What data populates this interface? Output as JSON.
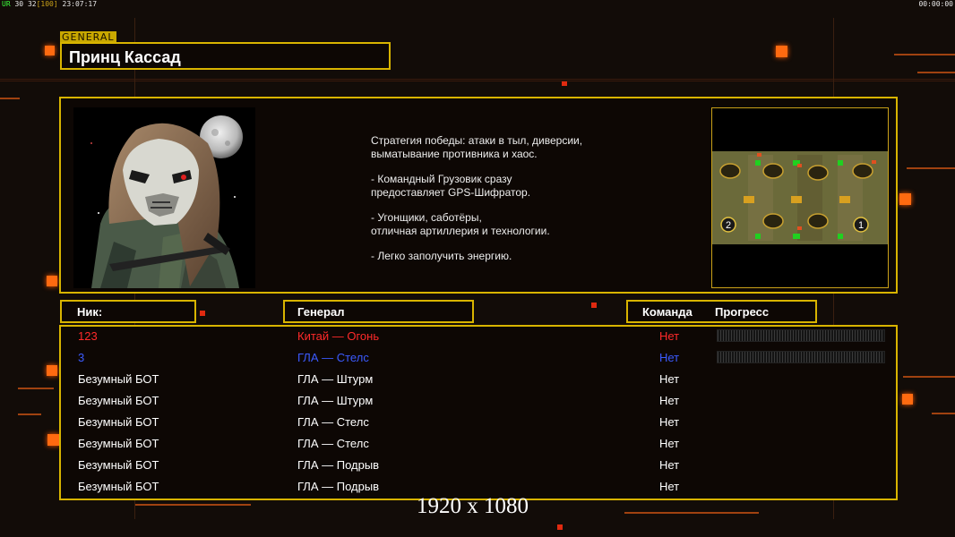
{
  "topbar": {
    "left_label": "UR",
    "left_fps": "30",
    "left_mid": "32",
    "left_bracket": "[100]",
    "left_time": "23:07:17",
    "right_time": "00:00:00"
  },
  "general_tag": "GENERAL",
  "general_name": "Принц Кассад",
  "description": [
    "Стратегия победы: атаки в тыл, диверсии,\n выматывание противника и хаос.",
    "- Командный Грузовик сразу\nпредоставляет GPS-Шифратор.",
    "- Угонщики, саботёры,\nотличная артиллерия и технологии.",
    "- Легко заполучить энергию."
  ],
  "map": {
    "spawn_labels": [
      "2",
      "1"
    ]
  },
  "headers": {
    "nick": "Ник:",
    "general": "Генерал",
    "team": "Команда",
    "progress": "Прогресс"
  },
  "players": [
    {
      "nick": "123",
      "general": "Китай — Огонь",
      "team": "Нет",
      "color": "#ff2a2a",
      "has_progress": true
    },
    {
      "nick": "3",
      "general": "ГЛА — Стелс",
      "team": "Нет",
      "color": "#3b5bff",
      "has_progress": true
    },
    {
      "nick": "Безумный БОТ",
      "general": "ГЛА — Штурм",
      "team": "Нет",
      "color": "#ffffff",
      "has_progress": false
    },
    {
      "nick": "Безумный БОТ",
      "general": "ГЛА — Штурм",
      "team": "Нет",
      "color": "#ffffff",
      "has_progress": false
    },
    {
      "nick": "Безумный БОТ",
      "general": "ГЛА — Стелс",
      "team": "Нет",
      "color": "#ffffff",
      "has_progress": false
    },
    {
      "nick": "Безумный БОТ",
      "general": "ГЛА — Стелс",
      "team": "Нет",
      "color": "#ffffff",
      "has_progress": false
    },
    {
      "nick": "Безумный БОТ",
      "general": "ГЛА — Подрыв",
      "team": "Нет",
      "color": "#ffffff",
      "has_progress": false
    },
    {
      "nick": "Безумный БОТ",
      "general": "ГЛА — Подрыв",
      "team": "Нет",
      "color": "#ffffff",
      "has_progress": false
    }
  ],
  "resolution_label": "1920 x 1080",
  "colors": {
    "accent": "#d8b400",
    "highlight_orange": "#ff6a10",
    "background": "#120c08"
  }
}
